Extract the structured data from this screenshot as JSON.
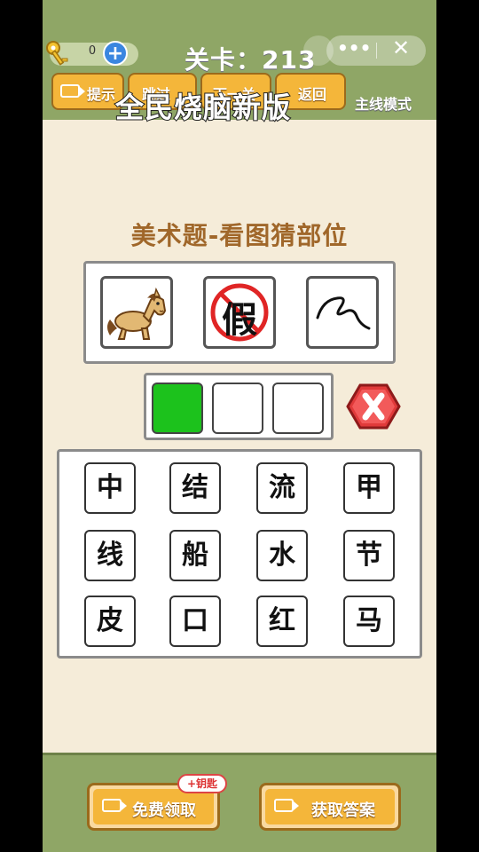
{
  "header": {
    "key_count": "0",
    "level_label": "关卡：213",
    "buttons": [
      "提示",
      "跳过",
      "下一关",
      "返回"
    ],
    "mode": "主线模式"
  },
  "overlay_title": "全民烧脑新版",
  "question": {
    "title": "美术题-看图猜部位",
    "clues": [
      {
        "icon": "horse-icon",
        "text": ""
      },
      {
        "icon": "no-fake-icon",
        "text": "假"
      },
      {
        "icon": "squiggle-icon",
        "text": ""
      }
    ],
    "answer_slots": [
      {
        "filled": true,
        "char": ""
      },
      {
        "filled": false,
        "char": ""
      },
      {
        "filled": false,
        "char": ""
      }
    ]
  },
  "char_grid": [
    [
      "中",
      "结",
      "流",
      "甲"
    ],
    [
      "线",
      "船",
      "水",
      "节"
    ],
    [
      "皮",
      "口",
      "红",
      "马"
    ]
  ],
  "footer": {
    "free_label": "免费领取",
    "badge": "+钥匙",
    "answer_label": "获取答案"
  },
  "colors": {
    "header_bg": "#8fa666",
    "page_bg": "#f5ecd9",
    "button_orange": "#f4b63a",
    "title_brown": "#a0672a",
    "slot_green": "#1cc21c",
    "plus_blue": "#3a86e0"
  }
}
